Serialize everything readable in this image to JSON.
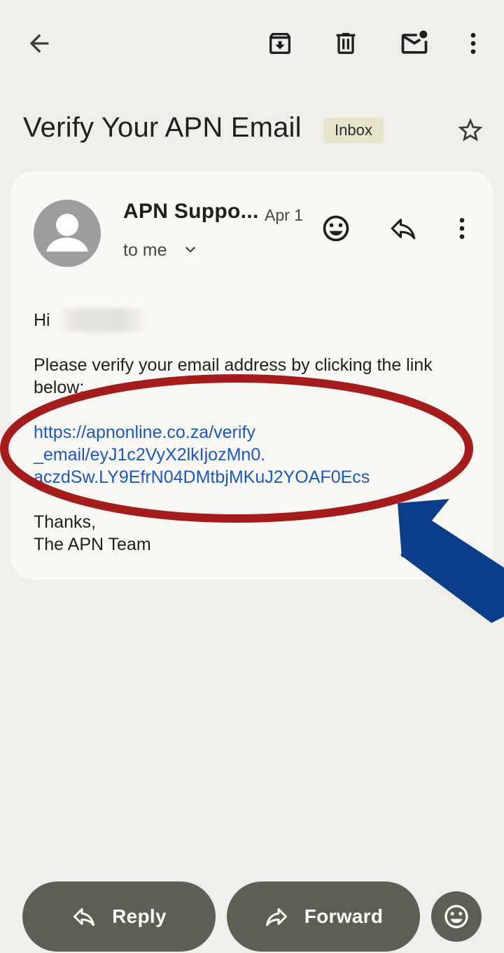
{
  "toolbar": {
    "back_icon": "arrow-back-icon",
    "archive_icon": "archive-icon",
    "delete_icon": "trash-icon",
    "mark_unread_icon": "mail-unread-icon",
    "more_icon": "more-vert-icon"
  },
  "subject": {
    "title": "Verify Your APN Email",
    "label": "Inbox",
    "star_icon": "star-outline-icon"
  },
  "message": {
    "sender": "APN Suppo...",
    "date": "Apr 1",
    "recipient": "to me",
    "greeting": "Hi",
    "intro": "Please verify your email address by clicking the link below:",
    "link_lines": [
      "https://apnonline.co.za/verify",
      "_email/eyJ1c2VyX2lkIjozMn0.",
      "aczdSw.LY9EfrN04DMtbjMKuJ2YOAF0Ecs"
    ],
    "signoff_line1": "Thanks,",
    "signoff_line2": "The APN Team"
  },
  "actions": {
    "reply_label": "Reply",
    "forward_label": "Forward",
    "emoji_icon": "add-reaction-icon"
  },
  "colors": {
    "background": "#f0eeea",
    "card": "#faf8f4",
    "link": "#1a57c7",
    "label_chip": "#e7e3c9",
    "pill": "#5e5e54",
    "annotation_ellipse": "#a51c1c",
    "annotation_arrow": "#0a3d8a"
  }
}
